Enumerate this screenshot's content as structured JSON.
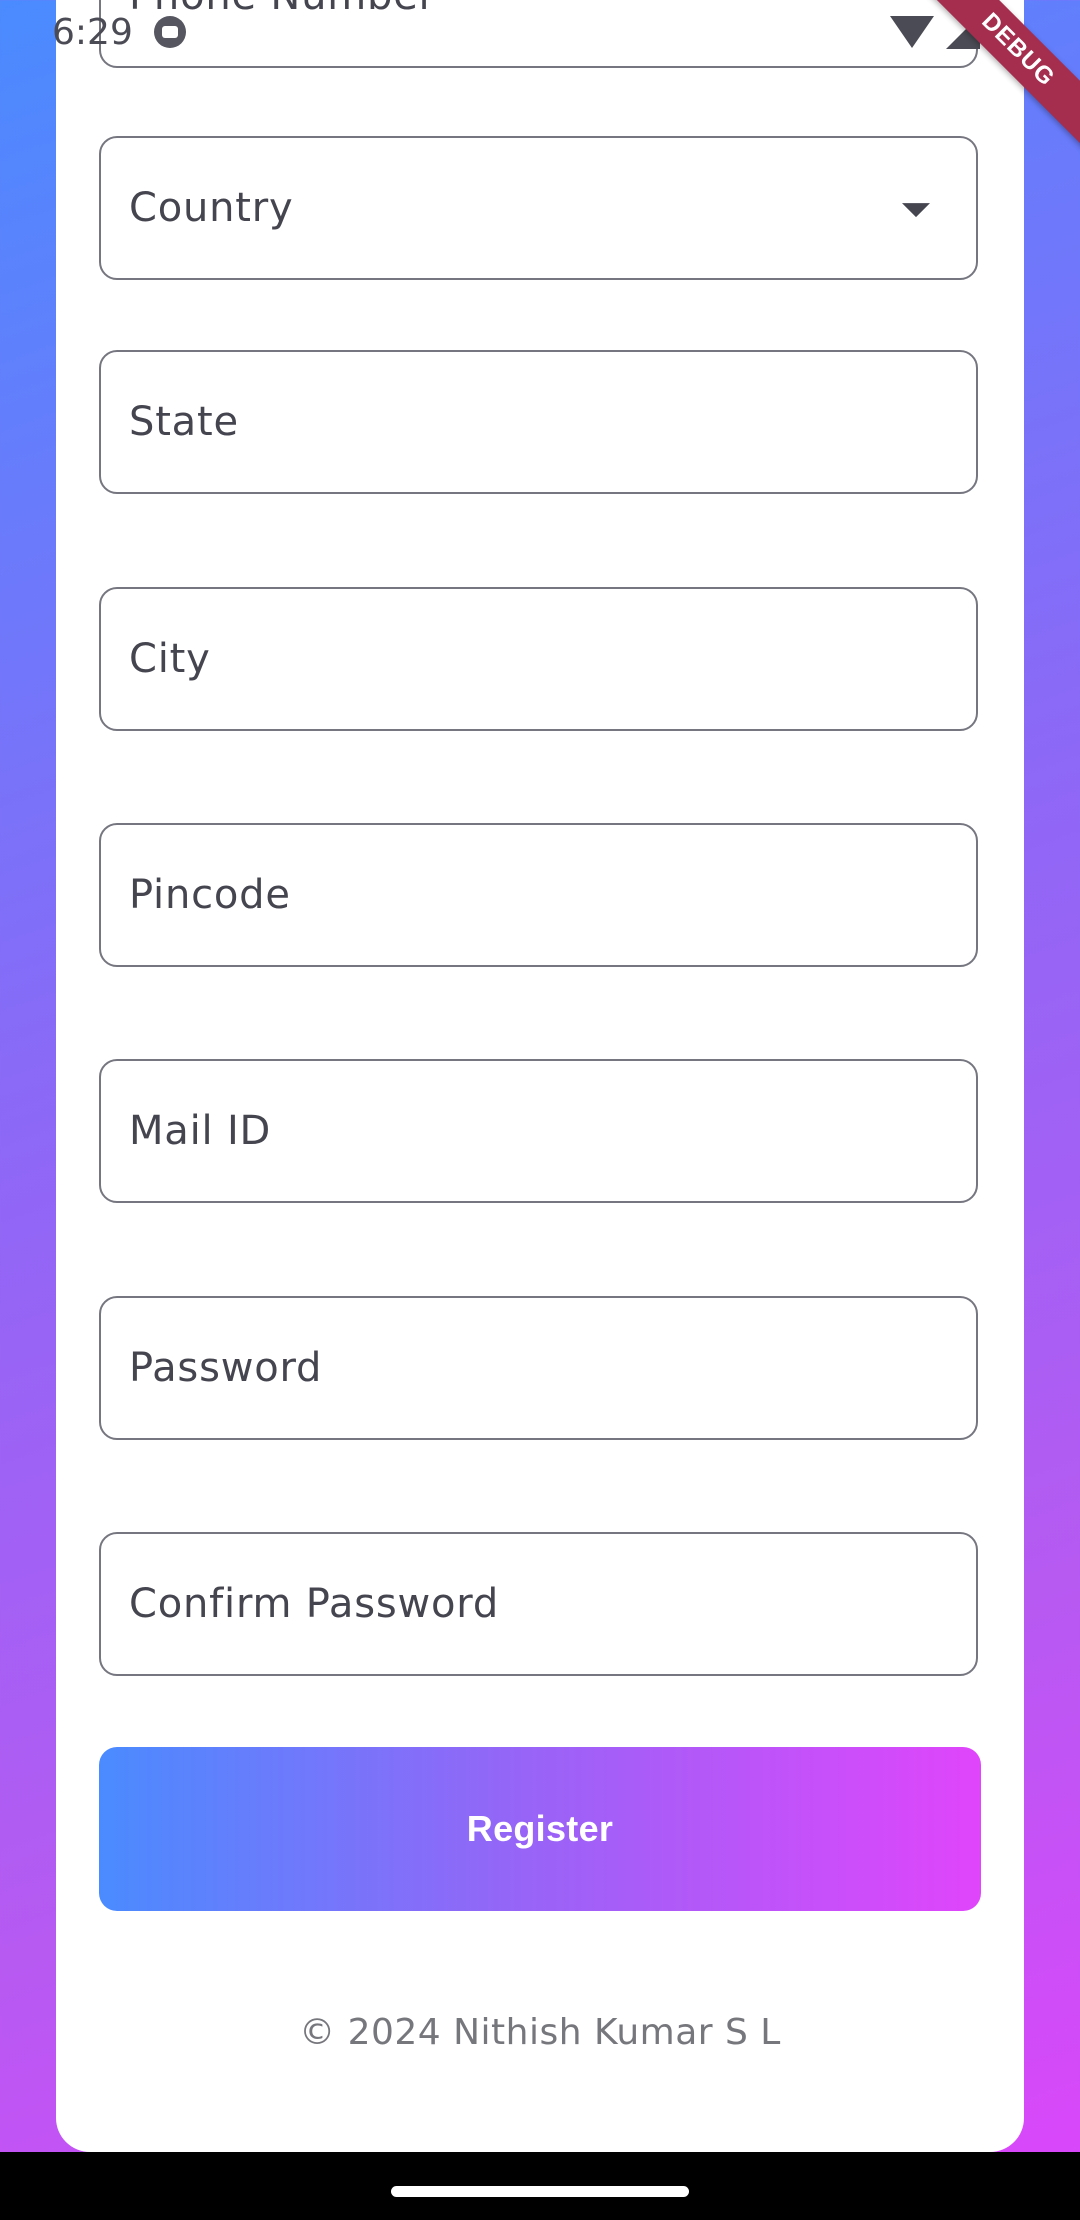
{
  "status_bar": {
    "time": "6:29",
    "debug_banner": "DEBUG"
  },
  "form": {
    "fields": [
      {
        "label": "Phone Number"
      },
      {
        "label": "Country"
      },
      {
        "label": "State"
      },
      {
        "label": "City"
      },
      {
        "label": "Pincode"
      },
      {
        "label": "Mail ID"
      },
      {
        "label": "Password"
      },
      {
        "label": "Confirm Password"
      }
    ],
    "register_label": "Register"
  },
  "footer": {
    "copyright": "© 2024 Nithish Kumar S L"
  },
  "colors": {
    "gradient_start": "#4a8bff",
    "gradient_mid": "#9a63f7",
    "gradient_end": "#e045fb",
    "field_border": "#767680",
    "debug_banner": "#a52d4d"
  }
}
